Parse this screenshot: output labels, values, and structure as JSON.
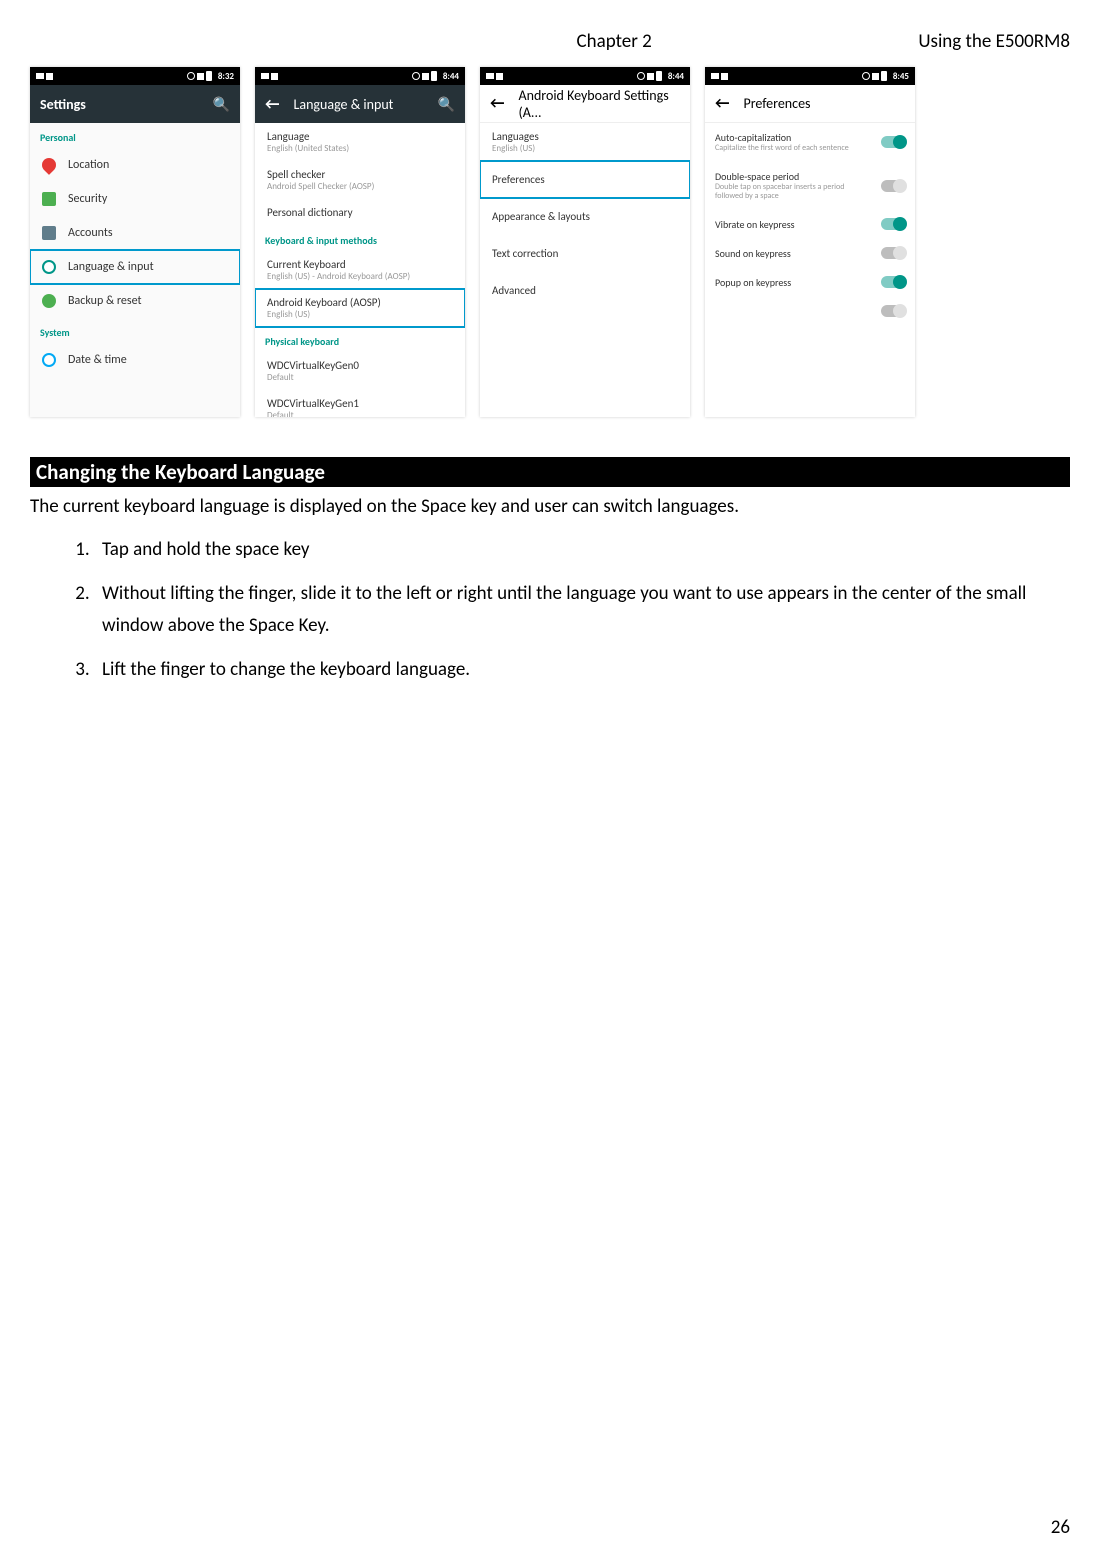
{
  "header": {
    "chapter": "Chapter 2",
    "title": "Using the E500RM8"
  },
  "page_number": "26",
  "screenshots": {
    "s1": {
      "time": "8:32",
      "title": "Settings",
      "cat_personal": "Personal",
      "items_personal": [
        "Location",
        "Security",
        "Accounts",
        "Language & input",
        "Backup & reset"
      ],
      "cat_system": "System",
      "items_system": [
        "Date & time"
      ]
    },
    "s2": {
      "time": "8:44",
      "title": "Language & input",
      "r1t": "Language",
      "r1s": "English (United States)",
      "r2t": "Spell checker",
      "r2s": "Android Spell Checker (AOSP)",
      "r3t": "Personal dictionary",
      "cat_k": "Keyboard & input methods",
      "r4t": "Current Keyboard",
      "r4s": "English (US) - Android Keyboard (AOSP)",
      "r5t": "Android Keyboard (AOSP)",
      "r5s": "English (US)",
      "cat_p": "Physical keyboard",
      "r6t": "WDCVirtualKeyGen0",
      "r6s": "Default",
      "r7t": "WDCVirtualKeyGen1",
      "r7s": "Default"
    },
    "s3": {
      "time": "8:44",
      "title": "Android Keyboard Settings (A...",
      "r1t": "Languages",
      "r1s": "English (US)",
      "r2": "Preferences",
      "r3": "Appearance & layouts",
      "r4": "Text correction",
      "r5": "Advanced"
    },
    "s4": {
      "time": "8:45",
      "title": "Preferences",
      "p1t": "Auto-capitalization",
      "p1s": "Capitalize the first word of each sentence",
      "p2t": "Double-space period",
      "p2s": "Double tap on spacebar inserts a period followed by a space",
      "p3t": "Vibrate on keypress",
      "p4t": "Sound on keypress",
      "p5t": "Popup on keypress"
    }
  },
  "section": {
    "heading": "Changing the Keyboard Language"
  },
  "body": "The current keyboard language is displayed on the Space key and user can switch languages.",
  "steps": [
    "Tap and hold the space key",
    "Without lifting the finger, slide it to the left or right until the language you want to use appears in the center of the small window above the Space Key.",
    "Lift the finger to change the keyboard language."
  ]
}
